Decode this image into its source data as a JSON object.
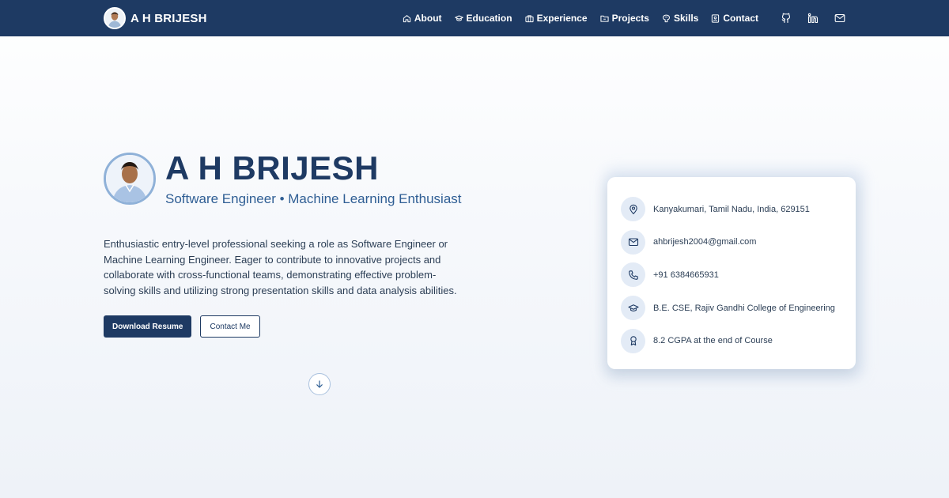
{
  "brand": {
    "name": "A H BRIJESH"
  },
  "nav": {
    "items": [
      {
        "label": "About",
        "icon": "home-icon"
      },
      {
        "label": "Education",
        "icon": "graduation-cap-icon"
      },
      {
        "label": "Experience",
        "icon": "briefcase-icon"
      },
      {
        "label": "Projects",
        "icon": "folder-icon"
      },
      {
        "label": "Skills",
        "icon": "brain-icon"
      },
      {
        "label": "Contact",
        "icon": "contact-card-icon"
      }
    ],
    "socials": [
      "github-icon",
      "linkedin-icon",
      "mail-icon"
    ]
  },
  "hero": {
    "name": "A H BRIJESH",
    "subtitle": "Software Engineer • Machine Learning Enthusiast",
    "description": "Enthusiastic entry-level professional seeking a role as Software Engineer or Machine Learning Engineer. Eager to contribute to innovative projects and collaborate with cross-functional teams, demonstrating effective problem-solving skills and utilizing strong presentation skills and data analysis abilities.",
    "download_label": "Download Resume",
    "contact_label": "Contact Me"
  },
  "info": {
    "items": [
      {
        "icon": "location-pin-icon",
        "text": "Kanyakumari, Tamil Nadu, India, 629151"
      },
      {
        "icon": "mail-icon",
        "text": "ahbrijesh2004@gmail.com"
      },
      {
        "icon": "phone-icon",
        "text": "+91 6384665931"
      },
      {
        "icon": "graduation-cap-icon",
        "text": "B.E. CSE, Rajiv Gandhi College of Engineering"
      },
      {
        "icon": "award-icon",
        "text": "8.2 CGPA at the end of Course"
      }
    ]
  },
  "colors": {
    "navy": "#1e3a63",
    "accent": "#2f5e94",
    "icon_bg": "#e3ebf6"
  }
}
